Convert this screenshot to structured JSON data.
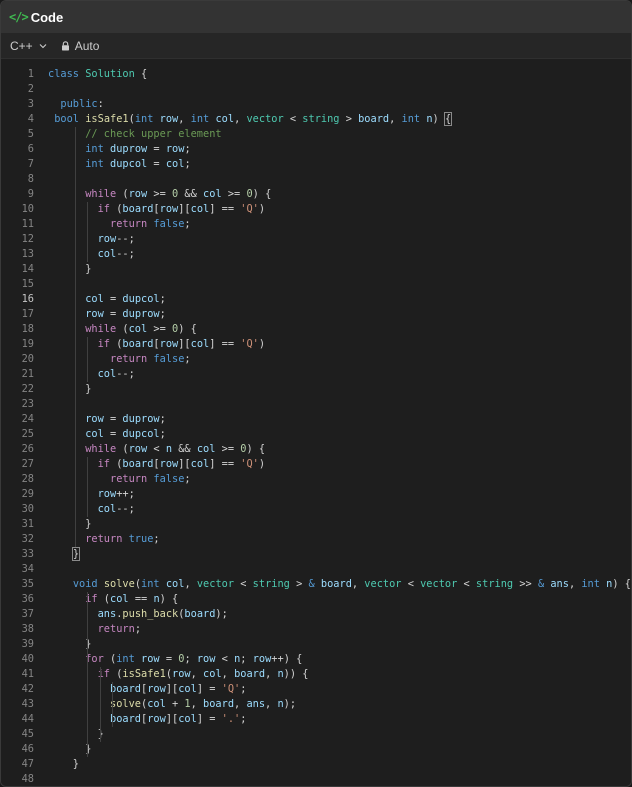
{
  "window": {
    "title": "Code",
    "title_icon": "</>"
  },
  "toolbar": {
    "language": "C++",
    "mode": "Auto"
  },
  "editor": {
    "active_line": 16,
    "lines": [
      [
        [
          "kw",
          "class"
        ],
        [
          "p",
          " "
        ],
        [
          "ty",
          "Solution"
        ],
        [
          "p",
          " {"
        ]
      ],
      [],
      [
        [
          "p",
          "  "
        ],
        [
          "kw",
          "public"
        ],
        [
          "p",
          ":"
        ]
      ],
      [
        [
          "p",
          " "
        ],
        [
          "kw",
          "bool"
        ],
        [
          "p",
          " "
        ],
        [
          "fn",
          "isSafe1"
        ],
        [
          "p",
          "("
        ],
        [
          "kw",
          "int"
        ],
        [
          "p",
          " "
        ],
        [
          "vr",
          "row"
        ],
        [
          "p",
          ", "
        ],
        [
          "kw",
          "int"
        ],
        [
          "p",
          " "
        ],
        [
          "vr",
          "col"
        ],
        [
          "p",
          ", "
        ],
        [
          "ty",
          "vector"
        ],
        [
          "p",
          " < "
        ],
        [
          "ty",
          "string"
        ],
        [
          "p",
          " > "
        ],
        [
          "vr",
          "board"
        ],
        [
          "p",
          ", "
        ],
        [
          "kw",
          "int"
        ],
        [
          "p",
          " "
        ],
        [
          "vr",
          "n"
        ],
        [
          "p",
          ") "
        ],
        [
          "br",
          "{"
        ]
      ],
      [
        [
          "p",
          "      "
        ],
        [
          "cm",
          "// check upper element"
        ]
      ],
      [
        [
          "p",
          "      "
        ],
        [
          "kw",
          "int"
        ],
        [
          "p",
          " "
        ],
        [
          "vr",
          "duprow"
        ],
        [
          "p",
          " = "
        ],
        [
          "vr",
          "row"
        ],
        [
          "p",
          ";"
        ]
      ],
      [
        [
          "p",
          "      "
        ],
        [
          "kw",
          "int"
        ],
        [
          "p",
          " "
        ],
        [
          "vr",
          "dupcol"
        ],
        [
          "p",
          " = "
        ],
        [
          "vr",
          "col"
        ],
        [
          "p",
          ";"
        ]
      ],
      [],
      [
        [
          "p",
          "      "
        ],
        [
          "ctl",
          "while"
        ],
        [
          "p",
          " ("
        ],
        [
          "vr",
          "row"
        ],
        [
          "p",
          " >= "
        ],
        [
          "nm",
          "0"
        ],
        [
          "p",
          " && "
        ],
        [
          "vr",
          "col"
        ],
        [
          "p",
          " >= "
        ],
        [
          "nm",
          "0"
        ],
        [
          "p",
          ") {"
        ]
      ],
      [
        [
          "p",
          "        "
        ],
        [
          "ctl",
          "if"
        ],
        [
          "p",
          " ("
        ],
        [
          "vr",
          "board"
        ],
        [
          "p",
          "["
        ],
        [
          "vr",
          "row"
        ],
        [
          "p",
          "]["
        ],
        [
          "vr",
          "col"
        ],
        [
          "p",
          "] == "
        ],
        [
          "st",
          "'Q'"
        ],
        [
          "p",
          ")"
        ]
      ],
      [
        [
          "p",
          "          "
        ],
        [
          "ctl",
          "return"
        ],
        [
          "p",
          " "
        ],
        [
          "kw",
          "false"
        ],
        [
          "p",
          ";"
        ]
      ],
      [
        [
          "p",
          "        "
        ],
        [
          "vr",
          "row"
        ],
        [
          "p",
          "--;"
        ]
      ],
      [
        [
          "p",
          "        "
        ],
        [
          "vr",
          "col"
        ],
        [
          "p",
          "--;"
        ]
      ],
      [
        [
          "p",
          "      }"
        ]
      ],
      [],
      [
        [
          "p",
          "      "
        ],
        [
          "vr",
          "col"
        ],
        [
          "p",
          " = "
        ],
        [
          "vr",
          "dupcol"
        ],
        [
          "p",
          ";"
        ]
      ],
      [
        [
          "p",
          "      "
        ],
        [
          "vr",
          "row"
        ],
        [
          "p",
          " = "
        ],
        [
          "vr",
          "duprow"
        ],
        [
          "p",
          ";"
        ]
      ],
      [
        [
          "p",
          "      "
        ],
        [
          "ctl",
          "while"
        ],
        [
          "p",
          " ("
        ],
        [
          "vr",
          "col"
        ],
        [
          "p",
          " >= "
        ],
        [
          "nm",
          "0"
        ],
        [
          "p",
          ") {"
        ]
      ],
      [
        [
          "p",
          "        "
        ],
        [
          "ctl",
          "if"
        ],
        [
          "p",
          " ("
        ],
        [
          "vr",
          "board"
        ],
        [
          "p",
          "["
        ],
        [
          "vr",
          "row"
        ],
        [
          "p",
          "]["
        ],
        [
          "vr",
          "col"
        ],
        [
          "p",
          "] == "
        ],
        [
          "st",
          "'Q'"
        ],
        [
          "p",
          ")"
        ]
      ],
      [
        [
          "p",
          "          "
        ],
        [
          "ctl",
          "return"
        ],
        [
          "p",
          " "
        ],
        [
          "kw",
          "false"
        ],
        [
          "p",
          ";"
        ]
      ],
      [
        [
          "p",
          "        "
        ],
        [
          "vr",
          "col"
        ],
        [
          "p",
          "--;"
        ]
      ],
      [
        [
          "p",
          "      }"
        ]
      ],
      [],
      [
        [
          "p",
          "      "
        ],
        [
          "vr",
          "row"
        ],
        [
          "p",
          " = "
        ],
        [
          "vr",
          "duprow"
        ],
        [
          "p",
          ";"
        ]
      ],
      [
        [
          "p",
          "      "
        ],
        [
          "vr",
          "col"
        ],
        [
          "p",
          " = "
        ],
        [
          "vr",
          "dupcol"
        ],
        [
          "p",
          ";"
        ]
      ],
      [
        [
          "p",
          "      "
        ],
        [
          "ctl",
          "while"
        ],
        [
          "p",
          " ("
        ],
        [
          "vr",
          "row"
        ],
        [
          "p",
          " < "
        ],
        [
          "vr",
          "n"
        ],
        [
          "p",
          " && "
        ],
        [
          "vr",
          "col"
        ],
        [
          "p",
          " >= "
        ],
        [
          "nm",
          "0"
        ],
        [
          "p",
          ") {"
        ]
      ],
      [
        [
          "p",
          "        "
        ],
        [
          "ctl",
          "if"
        ],
        [
          "p",
          " ("
        ],
        [
          "vr",
          "board"
        ],
        [
          "p",
          "["
        ],
        [
          "vr",
          "row"
        ],
        [
          "p",
          "]["
        ],
        [
          "vr",
          "col"
        ],
        [
          "p",
          "] == "
        ],
        [
          "st",
          "'Q'"
        ],
        [
          "p",
          ")"
        ]
      ],
      [
        [
          "p",
          "          "
        ],
        [
          "ctl",
          "return"
        ],
        [
          "p",
          " "
        ],
        [
          "kw",
          "false"
        ],
        [
          "p",
          ";"
        ]
      ],
      [
        [
          "p",
          "        "
        ],
        [
          "vr",
          "row"
        ],
        [
          "p",
          "++;"
        ]
      ],
      [
        [
          "p",
          "        "
        ],
        [
          "vr",
          "col"
        ],
        [
          "p",
          "--;"
        ]
      ],
      [
        [
          "p",
          "      }"
        ]
      ],
      [
        [
          "p",
          "      "
        ],
        [
          "ctl",
          "return"
        ],
        [
          "p",
          " "
        ],
        [
          "kw",
          "true"
        ],
        [
          "p",
          ";"
        ]
      ],
      [
        [
          "p",
          "    "
        ],
        [
          "br",
          "}"
        ]
      ],
      [],
      [
        [
          "p",
          "    "
        ],
        [
          "kw",
          "void"
        ],
        [
          "p",
          " "
        ],
        [
          "fn",
          "solve"
        ],
        [
          "p",
          "("
        ],
        [
          "kw",
          "int"
        ],
        [
          "p",
          " "
        ],
        [
          "vr",
          "col"
        ],
        [
          "p",
          ", "
        ],
        [
          "ty",
          "vector"
        ],
        [
          "p",
          " < "
        ],
        [
          "ty",
          "string"
        ],
        [
          "p",
          " > "
        ],
        [
          "kw",
          "&"
        ],
        [
          "p",
          " "
        ],
        [
          "vr",
          "board"
        ],
        [
          "p",
          ", "
        ],
        [
          "ty",
          "vector"
        ],
        [
          "p",
          " < "
        ],
        [
          "ty",
          "vector"
        ],
        [
          "p",
          " < "
        ],
        [
          "ty",
          "string"
        ],
        [
          "p",
          " >> "
        ],
        [
          "kw",
          "&"
        ],
        [
          "p",
          " "
        ],
        [
          "vr",
          "ans"
        ],
        [
          "p",
          ", "
        ],
        [
          "kw",
          "int"
        ],
        [
          "p",
          " "
        ],
        [
          "vr",
          "n"
        ],
        [
          "p",
          ") {"
        ]
      ],
      [
        [
          "p",
          "      "
        ],
        [
          "ctl",
          "if"
        ],
        [
          "p",
          " ("
        ],
        [
          "vr",
          "col"
        ],
        [
          "p",
          " == "
        ],
        [
          "vr",
          "n"
        ],
        [
          "p",
          ") {"
        ]
      ],
      [
        [
          "p",
          "        "
        ],
        [
          "vr",
          "ans"
        ],
        [
          "p",
          "."
        ],
        [
          "fn",
          "push_back"
        ],
        [
          "p",
          "("
        ],
        [
          "vr",
          "board"
        ],
        [
          "p",
          ");"
        ]
      ],
      [
        [
          "p",
          "        "
        ],
        [
          "ctl",
          "return"
        ],
        [
          "p",
          ";"
        ]
      ],
      [
        [
          "p",
          "      }"
        ]
      ],
      [
        [
          "p",
          "      "
        ],
        [
          "ctl",
          "for"
        ],
        [
          "p",
          " ("
        ],
        [
          "kw",
          "int"
        ],
        [
          "p",
          " "
        ],
        [
          "vr",
          "row"
        ],
        [
          "p",
          " = "
        ],
        [
          "nm",
          "0"
        ],
        [
          "p",
          "; "
        ],
        [
          "vr",
          "row"
        ],
        [
          "p",
          " < "
        ],
        [
          "vr",
          "n"
        ],
        [
          "p",
          "; "
        ],
        [
          "vr",
          "row"
        ],
        [
          "p",
          "++) {"
        ]
      ],
      [
        [
          "p",
          "        "
        ],
        [
          "ctl",
          "if"
        ],
        [
          "p",
          " ("
        ],
        [
          "fn",
          "isSafe1"
        ],
        [
          "p",
          "("
        ],
        [
          "vr",
          "row"
        ],
        [
          "p",
          ", "
        ],
        [
          "vr",
          "col"
        ],
        [
          "p",
          ", "
        ],
        [
          "vr",
          "board"
        ],
        [
          "p",
          ", "
        ],
        [
          "vr",
          "n"
        ],
        [
          "p",
          ")) {"
        ]
      ],
      [
        [
          "p",
          "          "
        ],
        [
          "vr",
          "board"
        ],
        [
          "p",
          "["
        ],
        [
          "vr",
          "row"
        ],
        [
          "p",
          "]["
        ],
        [
          "vr",
          "col"
        ],
        [
          "p",
          "] = "
        ],
        [
          "st",
          "'Q'"
        ],
        [
          "p",
          ";"
        ]
      ],
      [
        [
          "p",
          "          "
        ],
        [
          "fn",
          "solve"
        ],
        [
          "p",
          "("
        ],
        [
          "vr",
          "col"
        ],
        [
          "p",
          " + "
        ],
        [
          "nm",
          "1"
        ],
        [
          "p",
          ", "
        ],
        [
          "vr",
          "board"
        ],
        [
          "p",
          ", "
        ],
        [
          "vr",
          "ans"
        ],
        [
          "p",
          ", "
        ],
        [
          "vr",
          "n"
        ],
        [
          "p",
          ");"
        ]
      ],
      [
        [
          "p",
          "          "
        ],
        [
          "vr",
          "board"
        ],
        [
          "p",
          "["
        ],
        [
          "vr",
          "row"
        ],
        [
          "p",
          "]["
        ],
        [
          "vr",
          "col"
        ],
        [
          "p",
          "] = "
        ],
        [
          "st",
          "'.'"
        ],
        [
          "p",
          ";"
        ]
      ],
      [
        [
          "p",
          "        }"
        ]
      ],
      [
        [
          "p",
          "      }"
        ]
      ],
      [
        [
          "p",
          "    }"
        ]
      ],
      []
    ]
  }
}
